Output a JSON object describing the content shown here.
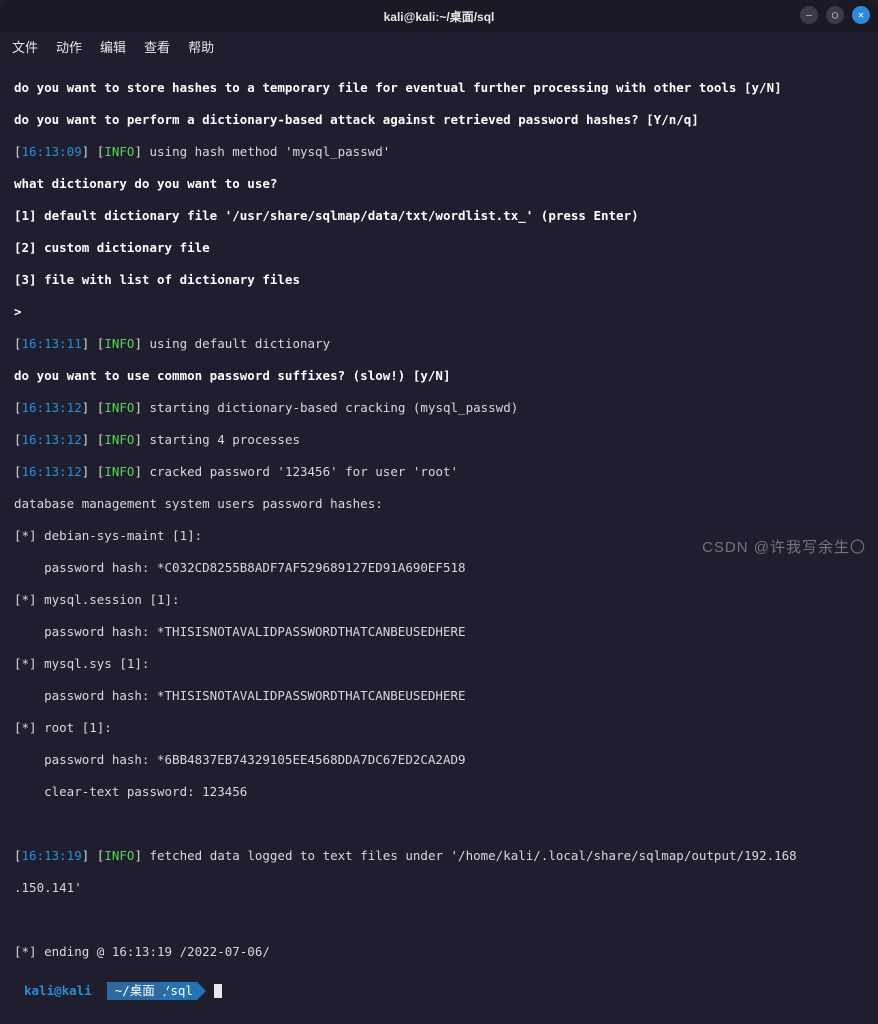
{
  "window": {
    "title": "kali@kali:~/桌面/sql"
  },
  "menu": {
    "file": "文件",
    "action": "动作",
    "edit": "编辑",
    "view": "查看",
    "help": "帮助"
  },
  "controls": {
    "min": "—",
    "max": "◯",
    "close": "✕"
  },
  "lines": {
    "q1": "do you want to store hashes to a temporary file for eventual further processing with other tools [y/N]",
    "q2": "do you want to perform a dictionary-based attack against retrieved password hashes? [Y/n/q]",
    "ts1": "16:13:09",
    "lv1": "INFO",
    "m1": " using hash method 'mysql_passwd'",
    "q3": "what dictionary do you want to use?",
    "d1": "[1] default dictionary file '/usr/share/sqlmap/data/txt/wordlist.tx_' (press Enter)",
    "d2": "[2] custom dictionary file",
    "d3": "[3] file with list of dictionary files",
    "gt": ">",
    "ts2": "16:13:11",
    "lv2": "INFO",
    "m2": " using default dictionary",
    "q4": "do you want to use common password suffixes? (slow!) [y/N]",
    "ts3": "16:13:12",
    "lv3": "INFO",
    "m3": " starting dictionary-based cracking (mysql_passwd)",
    "ts4": "16:13:12",
    "lv4": "INFO",
    "m4": " starting 4 processes",
    "ts5": "16:13:12",
    "lv5": "INFO",
    "m5": " cracked password '123456' for user 'root'",
    "hdr": "database management system users password hashes:",
    "u1": "[*] debian-sys-maint [1]:",
    "u1h": "    password hash: *C032CD8255B8ADF7AF529689127ED91A690EF518",
    "u2": "[*] mysql.session [1]:",
    "u2h": "    password hash: *THISISNOTAVALIDPASSWORDTHATCANBEUSEDHERE",
    "u3": "[*] mysql.sys [1]:",
    "u3h": "    password hash: *THISISNOTAVALIDPASSWORDTHATCANBEUSEDHERE",
    "u4": "[*] root [1]:",
    "u4h": "    password hash: *6BB4837EB74329105EE4568DDA7DC67ED2CA2AD9",
    "u4c": "    clear-text password: 123456",
    "ts6": "16:13:19",
    "lv6": "INFO",
    "m6": " fetched data logged to text files under '/home/kali/.local/share/sqlmap/output/192.168",
    "m6b": ".150.141'",
    "end": "[*] ending @ 16:13:19 /2022-07-06/"
  },
  "prompt": {
    "user": "kali@kali",
    "path1": "~/桌面",
    "path2": "/sql"
  },
  "watermark": "CSDN @许我写余生〇"
}
